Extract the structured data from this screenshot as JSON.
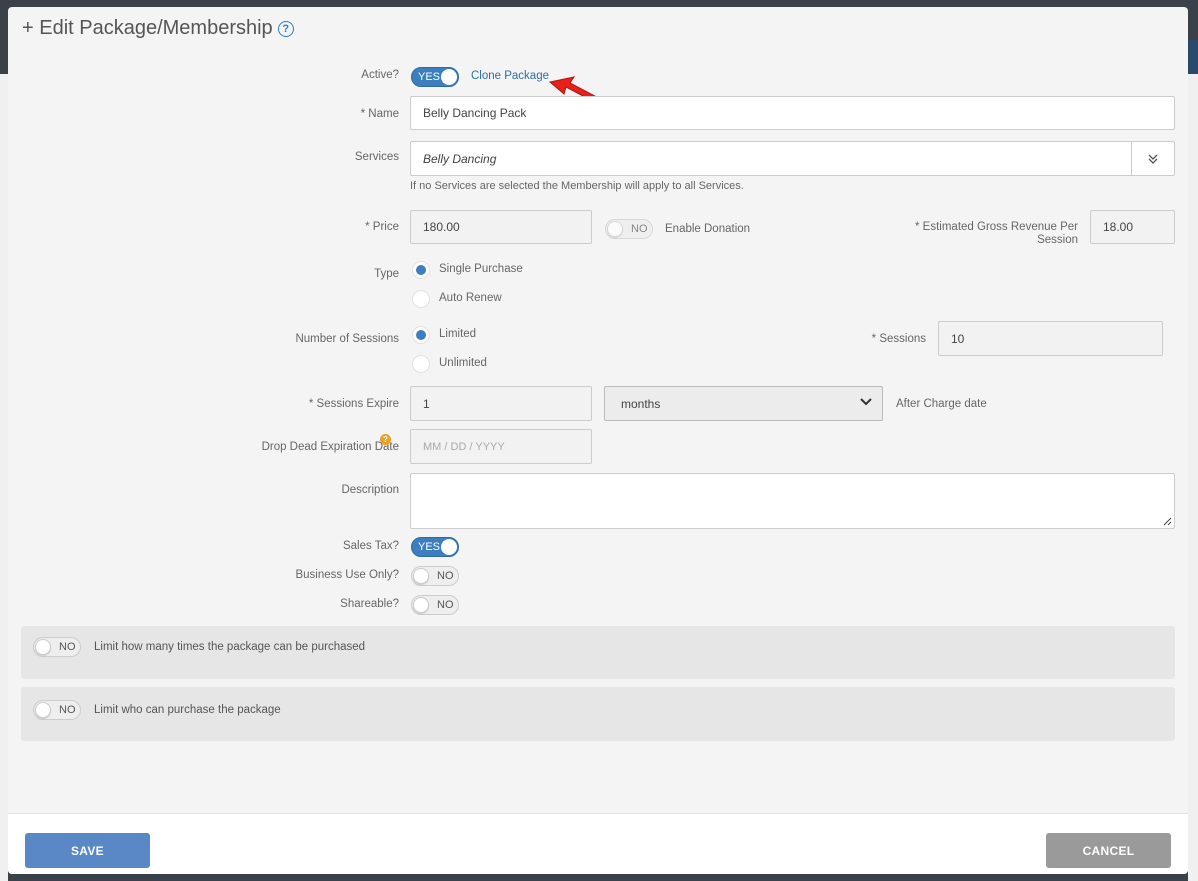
{
  "modal": {
    "title": "+ Edit Package/Membership",
    "help_glyph": "?"
  },
  "active": {
    "label": "Active?",
    "toggle": "YES",
    "clone_link": "Clone Package"
  },
  "name": {
    "label": "* Name",
    "value": "Belly Dancing Pack"
  },
  "services": {
    "label": "Services",
    "value": "Belly Dancing",
    "hint": "If no Services are selected the Membership will apply to all Services."
  },
  "price": {
    "label": "* Price",
    "value": "180.00",
    "donation_toggle": "NO",
    "donation_label": "Enable Donation"
  },
  "gross_revenue": {
    "label_line1": "* Estimated Gross Revenue Per",
    "label_line2": "Session",
    "value": "18.00"
  },
  "type": {
    "label": "Type",
    "options": [
      "Single Purchase",
      "Auto Renew"
    ],
    "selected": "Single Purchase"
  },
  "sessions_count": {
    "label": "Number of Sessions",
    "options": [
      "Limited",
      "Unlimited"
    ],
    "selected": "Limited",
    "sessions_label": "* Sessions",
    "sessions_value": "10"
  },
  "expire": {
    "label": "* Sessions Expire",
    "value": "1",
    "unit": "months",
    "suffix": "After Charge date"
  },
  "drop_dead": {
    "label": "Drop Dead Expiration Date",
    "placeholder": "MM / DD / YYYY",
    "warn_glyph": "?"
  },
  "description": {
    "label": "Description",
    "value": ""
  },
  "sales_tax": {
    "label": "Sales Tax?",
    "toggle": "YES"
  },
  "business_use": {
    "label": "Business Use Only?",
    "toggle": "NO"
  },
  "shareable": {
    "label": "Shareable?",
    "toggle": "NO"
  },
  "limit_purchases": {
    "toggle": "NO",
    "text": "Limit how many times the package can be purchased"
  },
  "limit_who": {
    "toggle": "NO",
    "text": "Limit who can purchase the package"
  },
  "footer": {
    "save": "SAVE",
    "cancel": "CANCEL"
  },
  "colors": {
    "accent": "#3c7ec0",
    "save_button": "#5a87c6",
    "cancel_button": "#9a9a9a",
    "annotation_arrow": "#e8201c"
  }
}
